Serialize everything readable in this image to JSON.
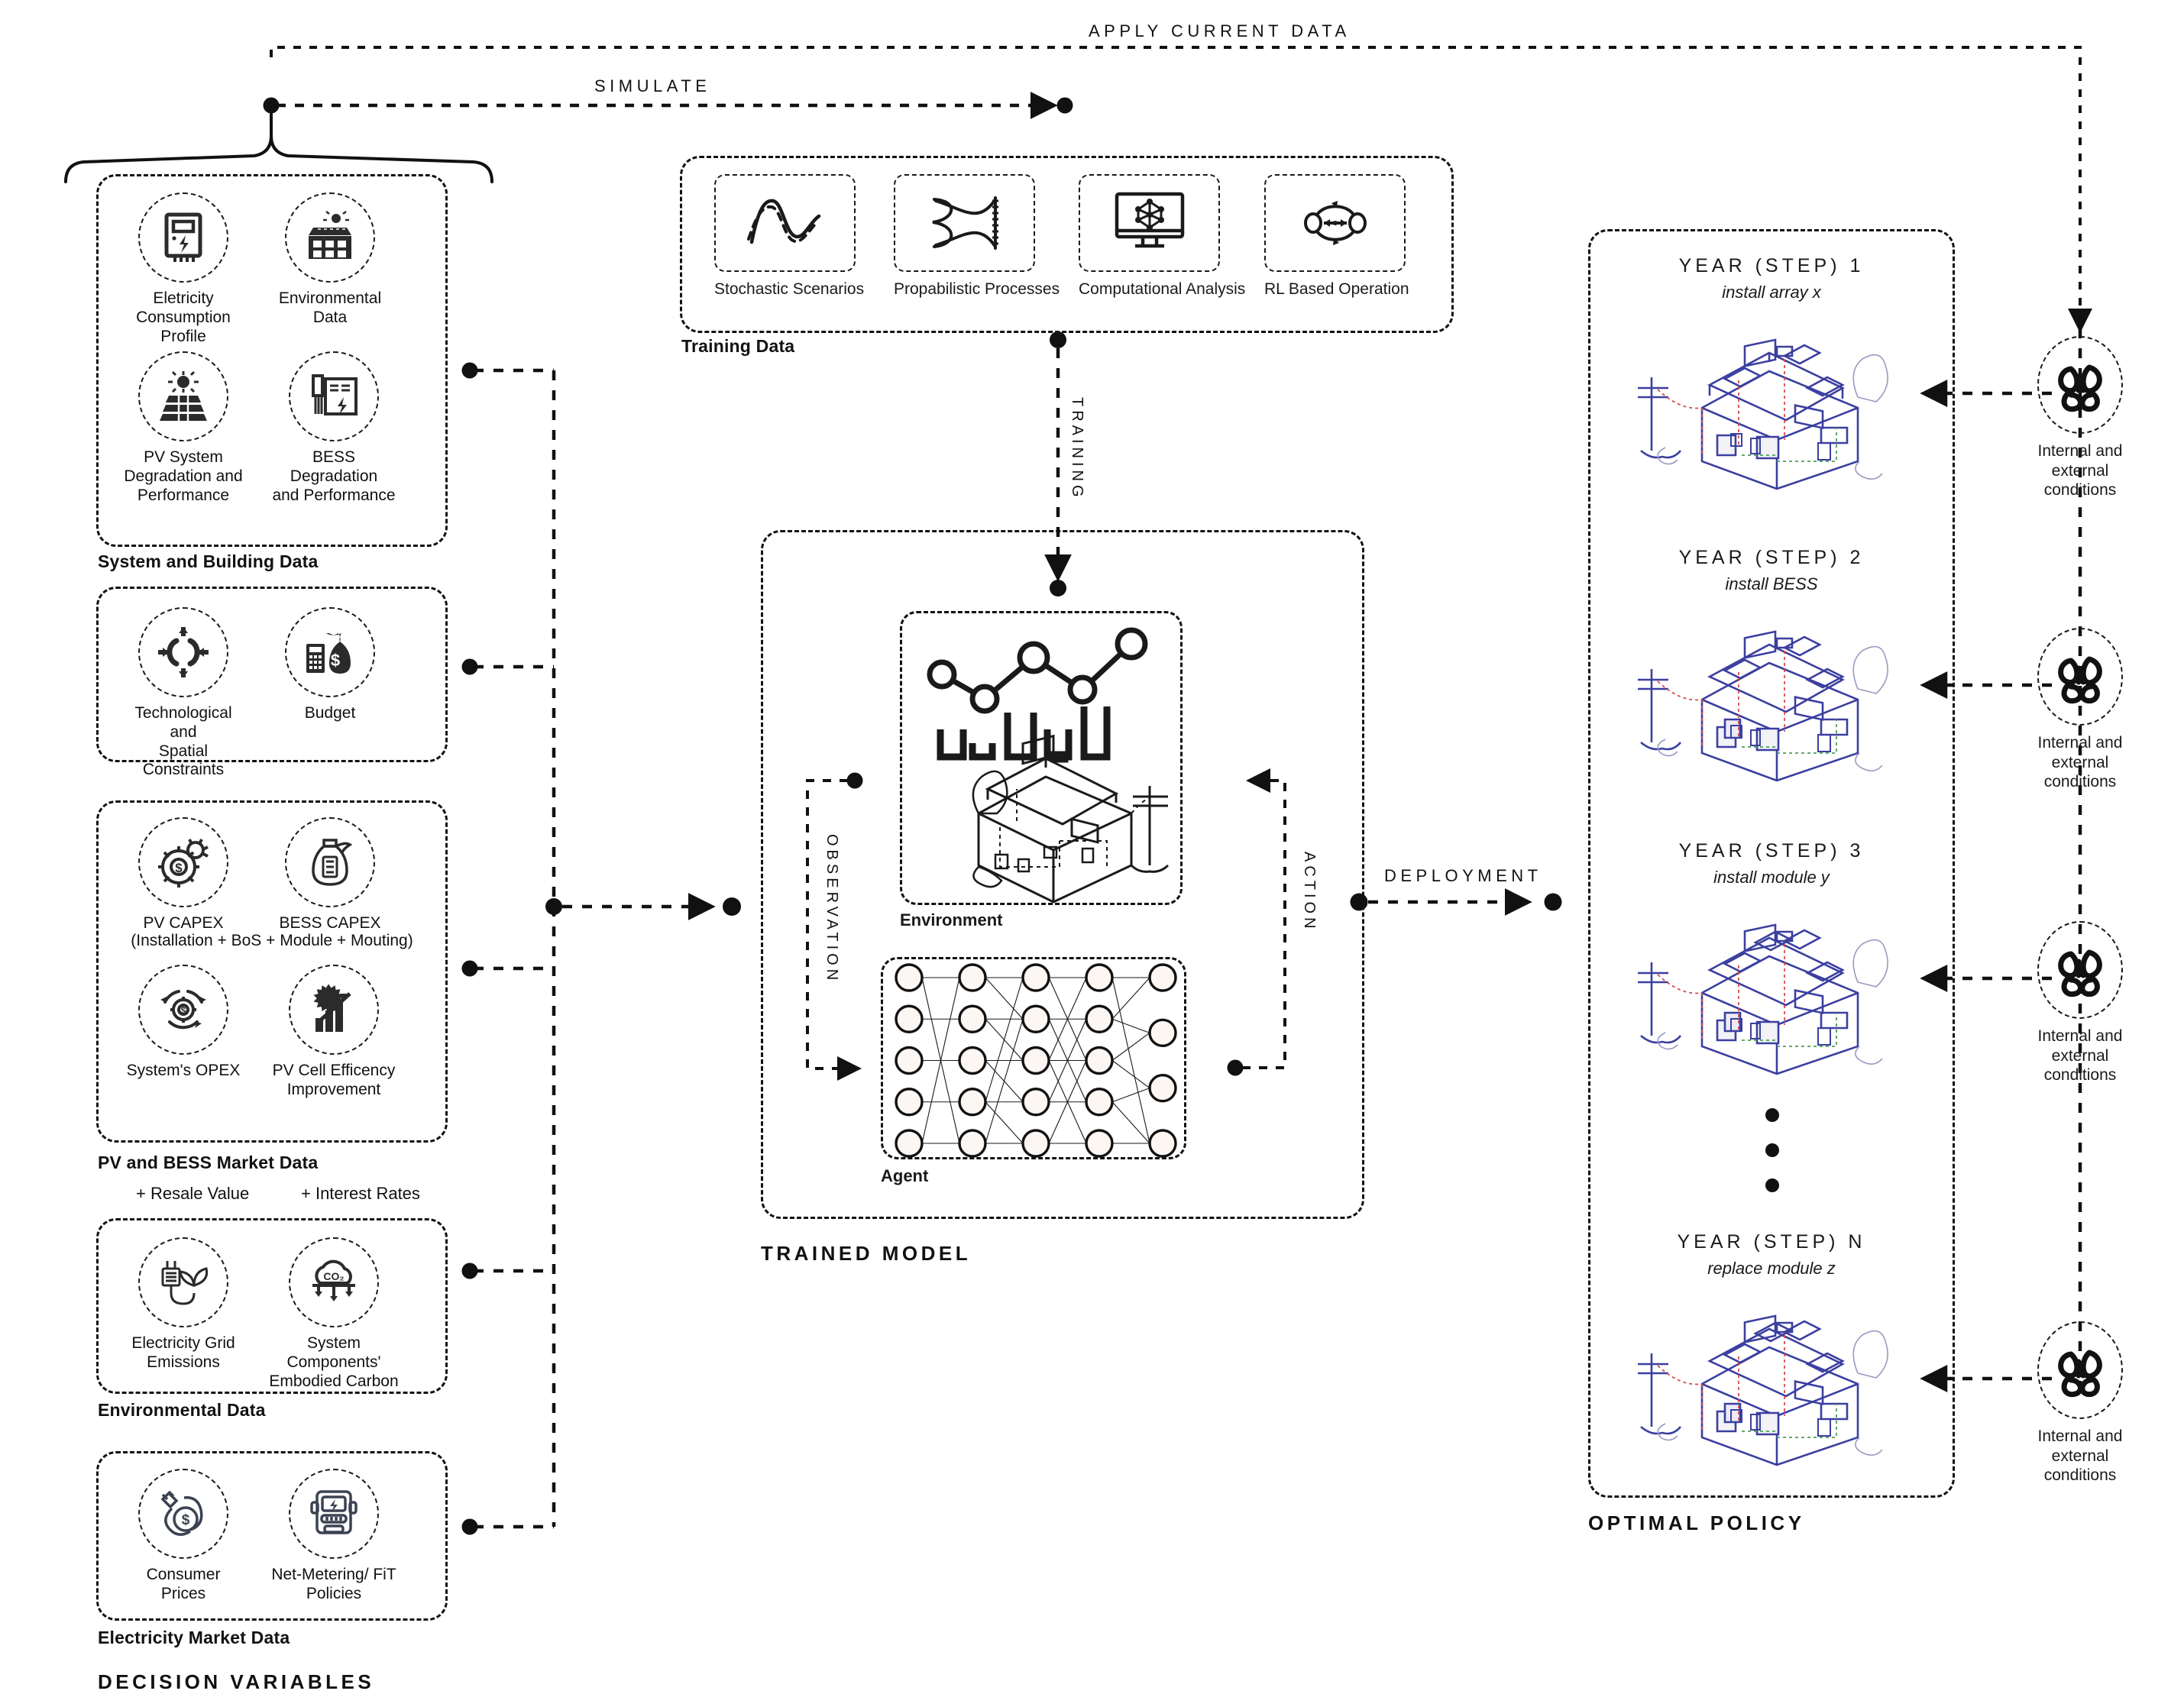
{
  "flows": {
    "apply_current_data": "APPLY CURRENT DATA",
    "simulate": "SIMULATE",
    "training": "TRAINING",
    "deployment": "DEPLOYMENT",
    "observation": "OBSERVATION",
    "action": "ACTION"
  },
  "sections": {
    "decision_variables": "DECISION VARIABLES",
    "trained_model": "TRAINED MODEL",
    "optimal_policy": "OPTIMAL POLICY",
    "training_data": "Training Data"
  },
  "decision_groups": [
    {
      "label": "System and Building Data",
      "halo": "#f0e9ea",
      "items": [
        {
          "label": "Eletricity\nConsumption Profile",
          "icon": "electricity-meter-icon"
        },
        {
          "label": "Environmental\nData",
          "icon": "solar-building-icon"
        },
        {
          "label": "PV System\nDegradation and\nPerformance",
          "icon": "pv-panel-sun-icon"
        },
        {
          "label": "BESS Degradation\nand Performance",
          "icon": "battery-cabinet-icon"
        }
      ]
    },
    {
      "label": "",
      "halo": "#e8f0e8",
      "items": [
        {
          "label": "Technological and\nSpatial Constraints",
          "icon": "constraints-arrows-icon"
        },
        {
          "label": "Budget",
          "icon": "money-bag-calculator-icon"
        }
      ]
    },
    {
      "label": "PV and BESS Market Data",
      "halo": "#faf0e8",
      "items": [
        {
          "label": "PV CAPEX",
          "icon": "gear-dollar-icon"
        },
        {
          "label": "BESS CAPEX",
          "icon": "battery-money-bag-icon"
        },
        {
          "label": "System's OPEX",
          "icon": "recycle-gear-dollar-icon"
        },
        {
          "label": "PV Cell Efficency\nImprovement",
          "icon": "pv-growth-arrow-icon"
        }
      ],
      "capex_note": "(Installation + BoS + Module + Mouting)",
      "extra_notes": [
        "+ Resale Value",
        "+ Interest Rates"
      ]
    },
    {
      "label": "Environmental Data",
      "halo": "#efebf2",
      "items": [
        {
          "label": "Electricity Grid\nEmissions",
          "icon": "plug-leaf-icon"
        },
        {
          "label": "System Components'\nEmbodied Carbon",
          "icon": "co2-cloud-icon"
        }
      ]
    },
    {
      "label": "Electricity Market Data",
      "halo": "#e9edf2",
      "items": [
        {
          "label": "Consumer Prices",
          "icon": "plug-dollar-icon"
        },
        {
          "label": "Net-Metering/ FiT\nPolicies",
          "icon": "smart-meter-icon"
        }
      ]
    }
  ],
  "training_data_items": [
    {
      "label": "Stochastic Scenarios",
      "icon": "stochastic-curve-icon"
    },
    {
      "label": "Propabilistic Processes",
      "icon": "probability-distribution-icon"
    },
    {
      "label": "Computational Analysis",
      "icon": "monitor-network-icon"
    },
    {
      "label": "RL Based Operation",
      "icon": "rl-loop-icon"
    }
  ],
  "trained_model": {
    "environment_label": "Environment",
    "agent_label": "Agent",
    "network": {
      "layers": [
        5,
        5,
        5,
        5,
        4
      ]
    }
  },
  "policy_steps": [
    {
      "title": "YEAR (STEP) 1",
      "sub": "install array x",
      "condition": "Internal and external\nconditions",
      "cond_icon": "tangled-knot-icon"
    },
    {
      "title": "YEAR (STEP) 2",
      "sub": "install BESS",
      "condition": "Internal and external\nconditions",
      "cond_icon": "tangled-knot-icon"
    },
    {
      "title": "YEAR (STEP) 3",
      "sub": "install module y",
      "condition": "Internal and external\nconditions",
      "cond_icon": "tangled-knot-icon"
    },
    {
      "title": "YEAR (STEP) N",
      "sub": "replace module z",
      "condition": "Internal and external\nconditions",
      "cond_icon": "tangled-knot-icon"
    }
  ],
  "colors": {
    "line": "#111111",
    "house_blue": "#3b3fa0",
    "house_red": "#d94a4a",
    "house_green": "#4f9d59",
    "panel_cream": "#fbf4f1",
    "card_grey": "#edeeea"
  }
}
